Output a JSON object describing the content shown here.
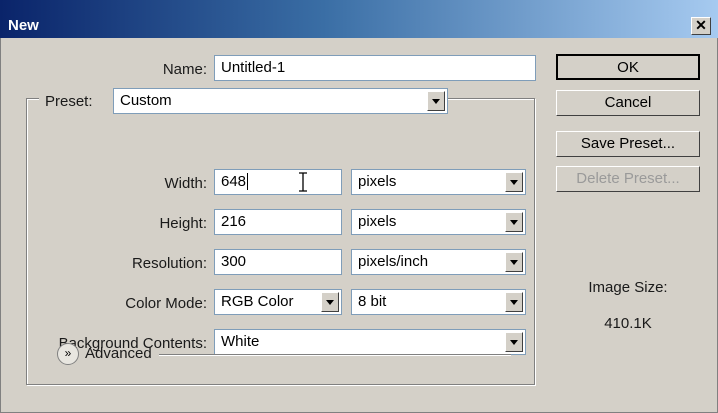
{
  "window": {
    "title": "New",
    "close_glyph": "✕"
  },
  "fields": {
    "name_label": "Name:",
    "name_value": "Untitled-1",
    "preset_label": "Preset:",
    "preset_value": "Custom",
    "width_label": "Width:",
    "width_value": "648",
    "width_unit": "pixels",
    "height_label": "Height:",
    "height_value": "216",
    "height_unit": "pixels",
    "resolution_label": "Resolution:",
    "resolution_value": "300",
    "resolution_unit": "pixels/inch",
    "color_mode_label": "Color Mode:",
    "color_mode_value": "RGB Color",
    "bit_depth_value": "8 bit",
    "background_label": "Background Contents:",
    "background_value": "White",
    "advanced_label": "Advanced"
  },
  "buttons": {
    "ok": "OK",
    "cancel": "Cancel",
    "save_preset": "Save Preset...",
    "delete_preset": "Delete Preset..."
  },
  "image_size": {
    "label": "Image Size:",
    "value": "410.1K"
  },
  "colors": {
    "dialog_bg": "#d4d0c8",
    "titlebar": "#0a246a",
    "border": "#7f9db9"
  }
}
